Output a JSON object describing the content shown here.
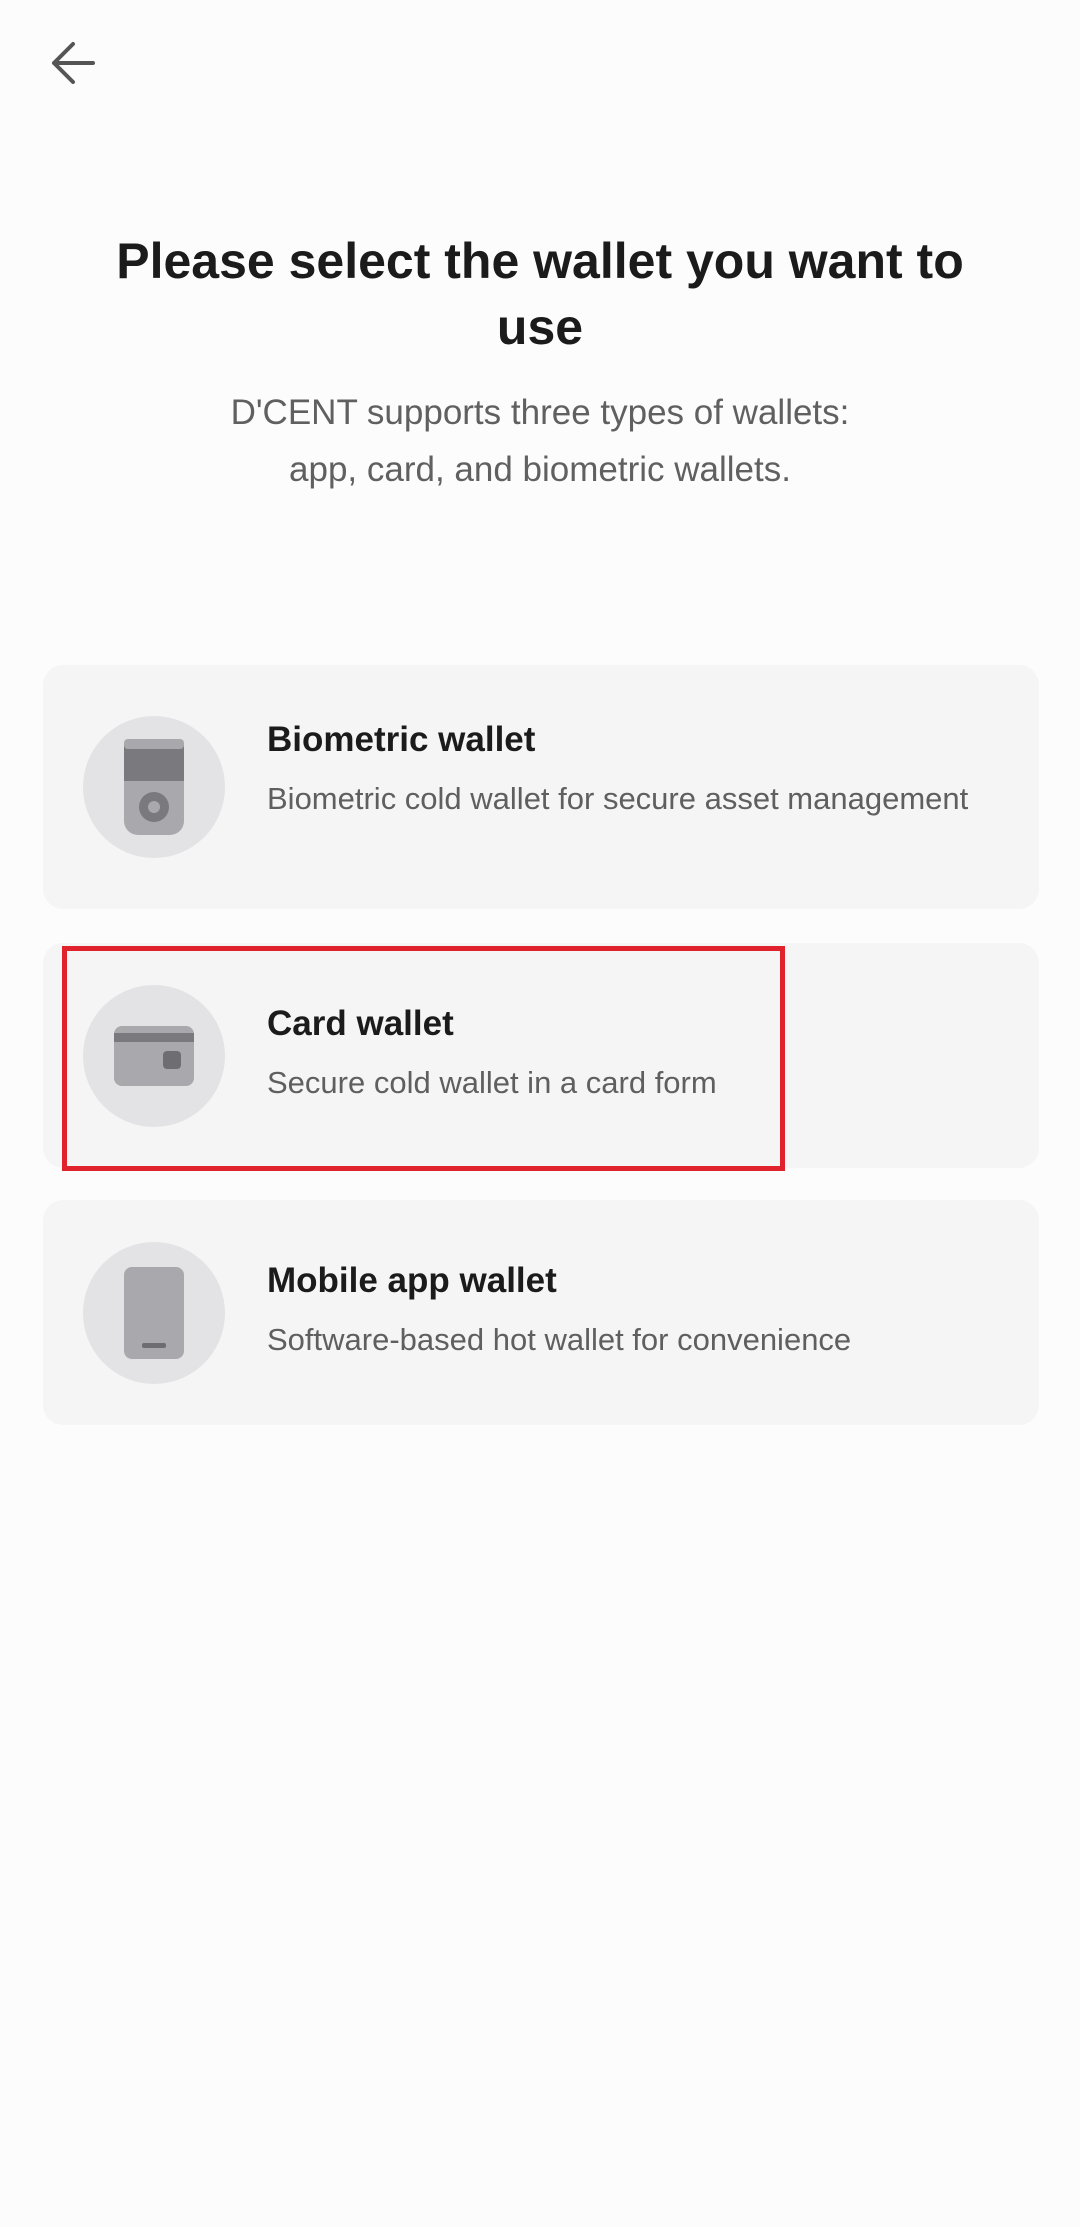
{
  "header": {
    "back_icon": "arrow-left-icon"
  },
  "title": "Please select the wallet you want to use",
  "subtitle": {
    "line1": "D'CENT supports three types of wallets:",
    "line2": "app, card, and biometric wallets."
  },
  "wallets": [
    {
      "icon": "biometric-device-icon",
      "title": "Biometric wallet",
      "description": "Biometric cold wallet for secure asset management"
    },
    {
      "icon": "card-icon",
      "title": "Card wallet",
      "description": "Secure cold wallet in a card form"
    },
    {
      "icon": "mobile-phone-icon",
      "title": "Mobile app wallet",
      "description": "Software-based hot wallet for convenience"
    }
  ],
  "colors": {
    "background": "#fcfcfc",
    "card_background": "#f5f5f5",
    "icon_circle": "#e3e3e5",
    "highlight": "#e0222d",
    "title_text": "#1b1b1b",
    "secondary_text": "#5f5f5f"
  }
}
